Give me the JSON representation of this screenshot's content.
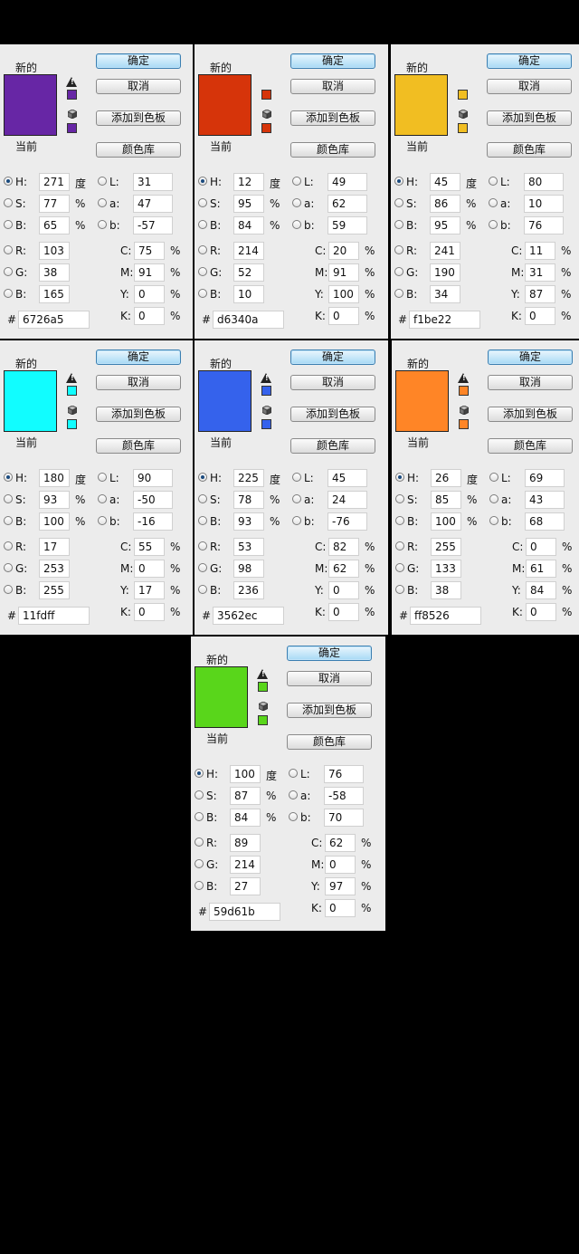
{
  "labels": {
    "new": "新的",
    "current": "当前",
    "ok": "确定",
    "cancel": "取消",
    "add_to_swatches": "添加到色板",
    "color_libraries": "颜色库",
    "H": "H:",
    "S": "S:",
    "B": "B:",
    "R": "R:",
    "G": "G:",
    "Bl": "B:",
    "L": "L:",
    "a": "a:",
    "b": "b:",
    "C": "C:",
    "M": "M:",
    "Y": "Y:",
    "K": "K:",
    "degree": "度",
    "percent": "%",
    "hash": "#",
    "warn_glyph": "!"
  },
  "dialogs": [
    {
      "color": "#6726a5",
      "h": "271",
      "s": "77",
      "b": "65",
      "r": "103",
      "g": "38",
      "bl": "165",
      "l": "31",
      "a": "47",
      "lab_b": "-57",
      "c": "75",
      "m": "91",
      "y": "0",
      "k": "0",
      "hex": "6726a5",
      "gamut_warning": true
    },
    {
      "color": "#d6340a",
      "h": "12",
      "s": "95",
      "b": "84",
      "r": "214",
      "g": "52",
      "bl": "10",
      "l": "49",
      "a": "62",
      "lab_b": "59",
      "c": "20",
      "m": "91",
      "y": "100",
      "k": "0",
      "hex": "d6340a",
      "gamut_warning": false
    },
    {
      "color": "#f1be22",
      "h": "45",
      "s": "86",
      "b": "95",
      "r": "241",
      "g": "190",
      "bl": "34",
      "l": "80",
      "a": "10",
      "lab_b": "76",
      "c": "11",
      "m": "31",
      "y": "87",
      "k": "0",
      "hex": "f1be22",
      "gamut_warning": false
    },
    {
      "color": "#11fdff",
      "h": "180",
      "s": "93",
      "b": "100",
      "r": "17",
      "g": "253",
      "bl": "255",
      "l": "90",
      "a": "-50",
      "lab_b": "-16",
      "c": "55",
      "m": "0",
      "y": "17",
      "k": "0",
      "hex": "11fdff",
      "gamut_warning": true
    },
    {
      "color": "#3562ec",
      "h": "225",
      "s": "78",
      "b": "93",
      "r": "53",
      "g": "98",
      "bl": "236",
      "l": "45",
      "a": "24",
      "lab_b": "-76",
      "c": "82",
      "m": "62",
      "y": "0",
      "k": "0",
      "hex": "3562ec",
      "gamut_warning": true
    },
    {
      "color": "#ff8526",
      "h": "26",
      "s": "85",
      "b": "100",
      "r": "255",
      "g": "133",
      "bl": "38",
      "l": "69",
      "a": "43",
      "lab_b": "68",
      "c": "0",
      "m": "61",
      "y": "84",
      "k": "0",
      "hex": "ff8526",
      "gamut_warning": true
    },
    {
      "color": "#59d61b",
      "h": "100",
      "s": "87",
      "b": "84",
      "r": "89",
      "g": "214",
      "bl": "27",
      "l": "76",
      "a": "-58",
      "lab_b": "70",
      "c": "62",
      "m": "0",
      "y": "97",
      "k": "0",
      "hex": "59d61b",
      "gamut_warning": true
    }
  ],
  "colors": {
    "page_bg": "#000000",
    "panel_bg": "#ececec",
    "ok_button": "#a7d9f5"
  }
}
